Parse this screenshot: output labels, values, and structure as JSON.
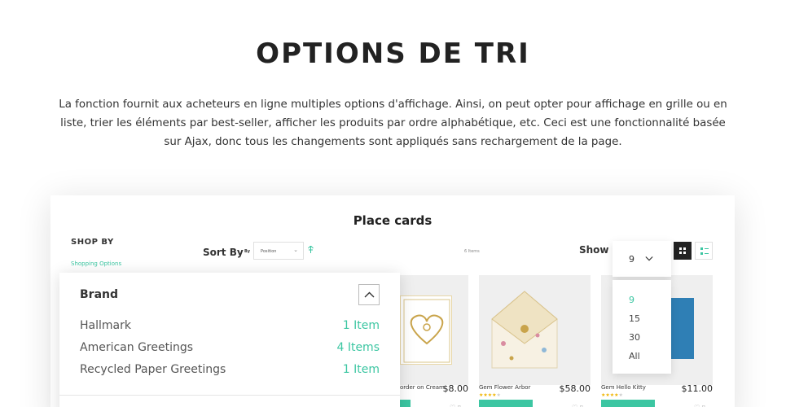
{
  "hero": {
    "title": "OPTIONS DE TRI",
    "description": "La fonction fournit aux acheteurs en ligne multiples options d'affichage. Ainsi, on peut opter pour affichage en grille ou en liste, trier les éléments par best-seller, afficher les produits par ordre alphabétique, etc. Ceci est une fonctionnalité basée sur Ajax, donc tous les changements sont appliqués sans rechargement de la page."
  },
  "shop": {
    "page_title": "Place cards",
    "shop_by_label": "SHOP BY",
    "shopping_options_label": "Shopping Options",
    "sort_by_label": "Sort By",
    "sort_by_small": "By",
    "sort_select_value": "Position",
    "items_count": "6 Items",
    "show_label": "Show",
    "show_selected": "9",
    "show_options": [
      "9",
      "15",
      "30",
      "All"
    ],
    "accent_color": "#3cc6a2"
  },
  "brand_filter": {
    "title": "Brand",
    "items": [
      {
        "name": "Hallmark",
        "count": "1 Item"
      },
      {
        "name": "American Greetings",
        "count": "4 Items"
      },
      {
        "name": "Recycled Paper Greetings",
        "count": "1 Item"
      }
    ]
  },
  "products": [
    {
      "name": "order on Cream",
      "price": "$8.00"
    },
    {
      "name": "Gem Flower Arbor",
      "price": "$58.00"
    },
    {
      "name": "Gem Hello Kitty",
      "price": "$11.00"
    }
  ]
}
